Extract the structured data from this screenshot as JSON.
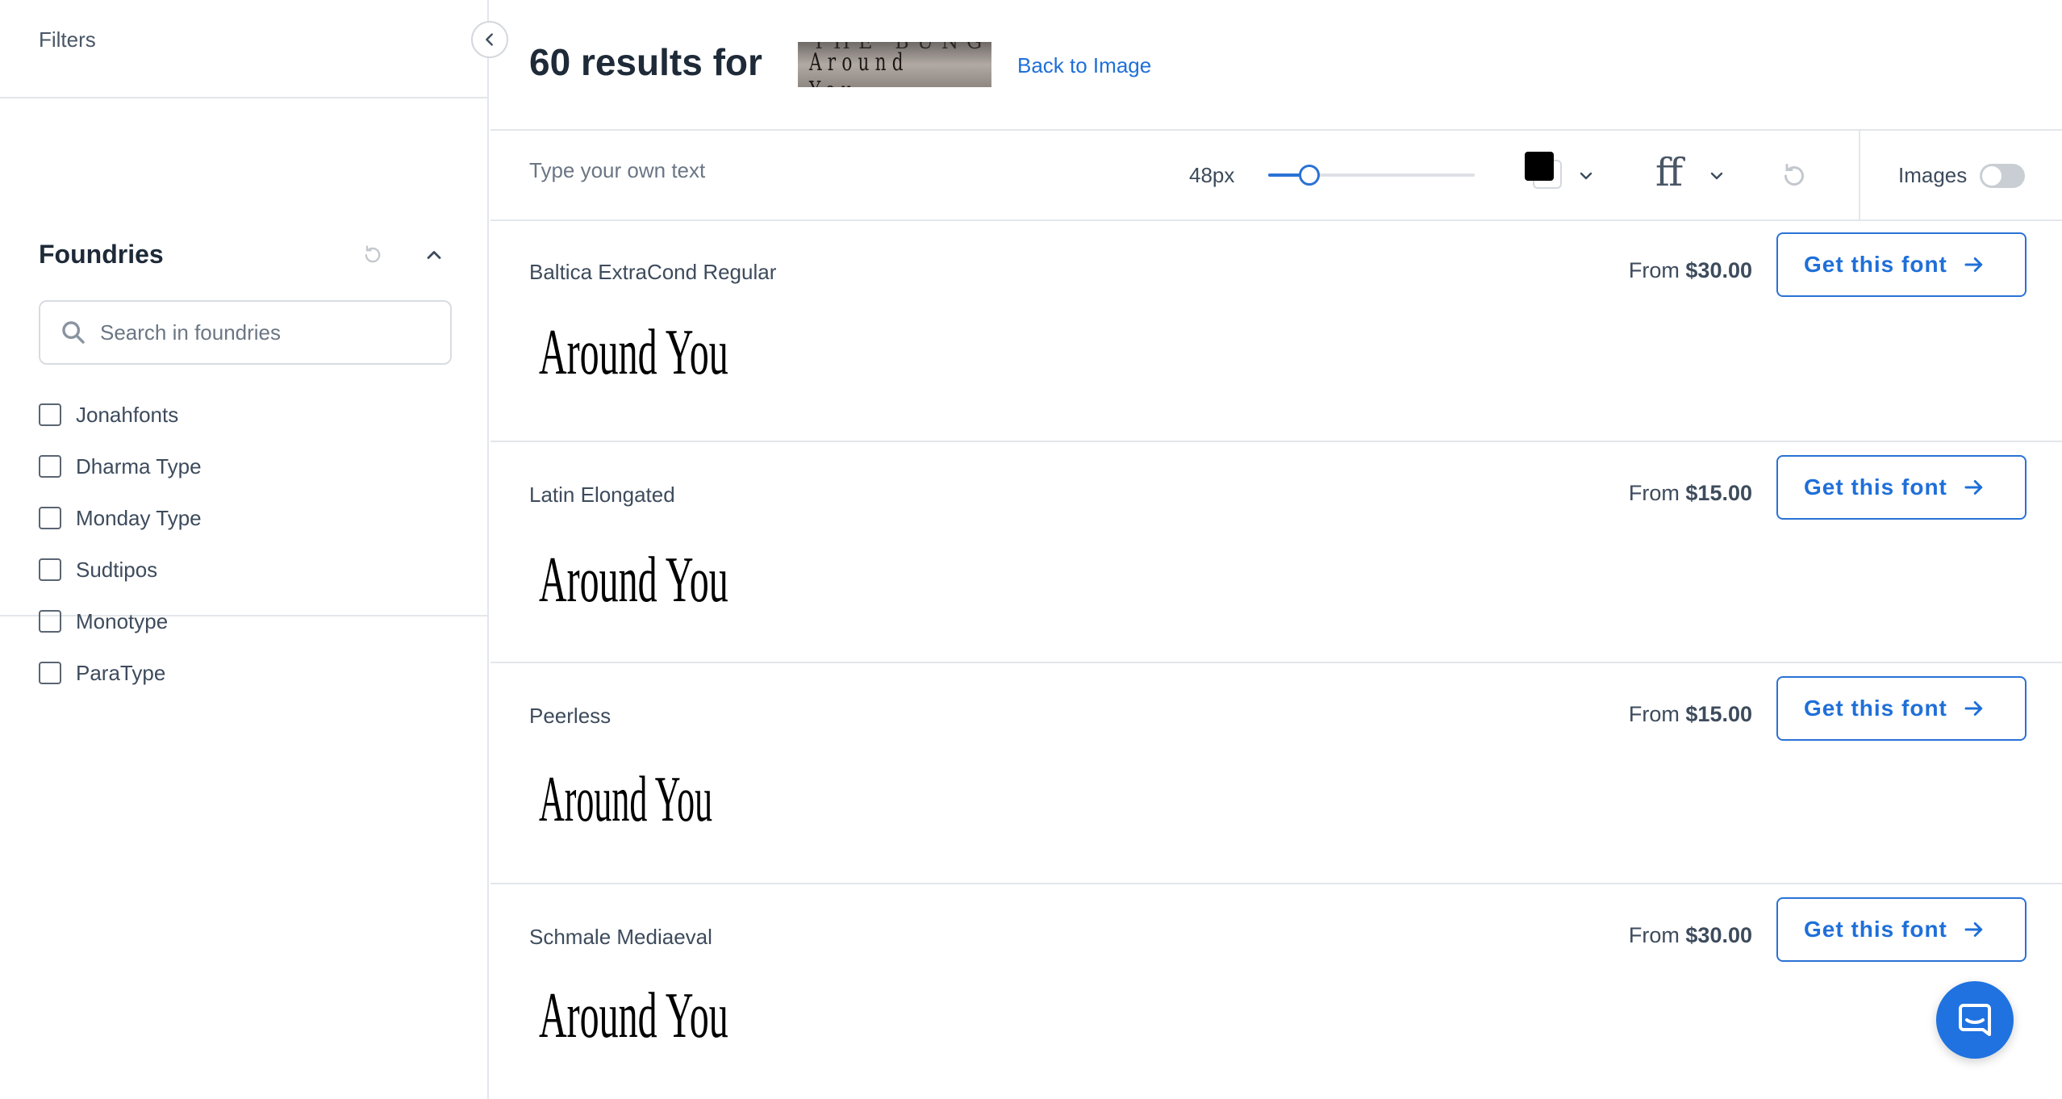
{
  "sidebar": {
    "filters_label": "Filters",
    "section_title": "Foundries",
    "search_placeholder": "Search in foundries",
    "foundries": [
      "Jonahfonts",
      "Dharma Type",
      "Monday Type",
      "Sudtipos",
      "Monotype",
      "ParaType"
    ]
  },
  "header": {
    "results_count": "60",
    "results_label": "60 results for",
    "query_image_text": "Around You",
    "back_link": "Back to Image"
  },
  "toolbar": {
    "text_placeholder": "Type your own text",
    "size_label": "48px",
    "size_fraction": 0.2,
    "color": "#000000",
    "font_features_label": "ff",
    "images_label": "Images",
    "images_enabled": false
  },
  "results": [
    {
      "name": "Baltica ExtraCond Regular",
      "price_prefix": "From",
      "price": "$30.00",
      "button": "Get this font",
      "sample": "Around You"
    },
    {
      "name": "Latin Elongated",
      "price_prefix": "From",
      "price": "$15.00",
      "button": "Get this font",
      "sample": "Around You"
    },
    {
      "name": "Peerless",
      "price_prefix": "From",
      "price": "$15.00",
      "button": "Get this font",
      "sample": "Around You"
    },
    {
      "name": "Schmale Mediaeval",
      "price_prefix": "From",
      "price": "$30.00",
      "button": "Get this font",
      "sample": "Around You"
    }
  ],
  "colors": {
    "accent": "#2a72d5",
    "link": "#1f6fd8",
    "chat": "#1f72e0"
  }
}
